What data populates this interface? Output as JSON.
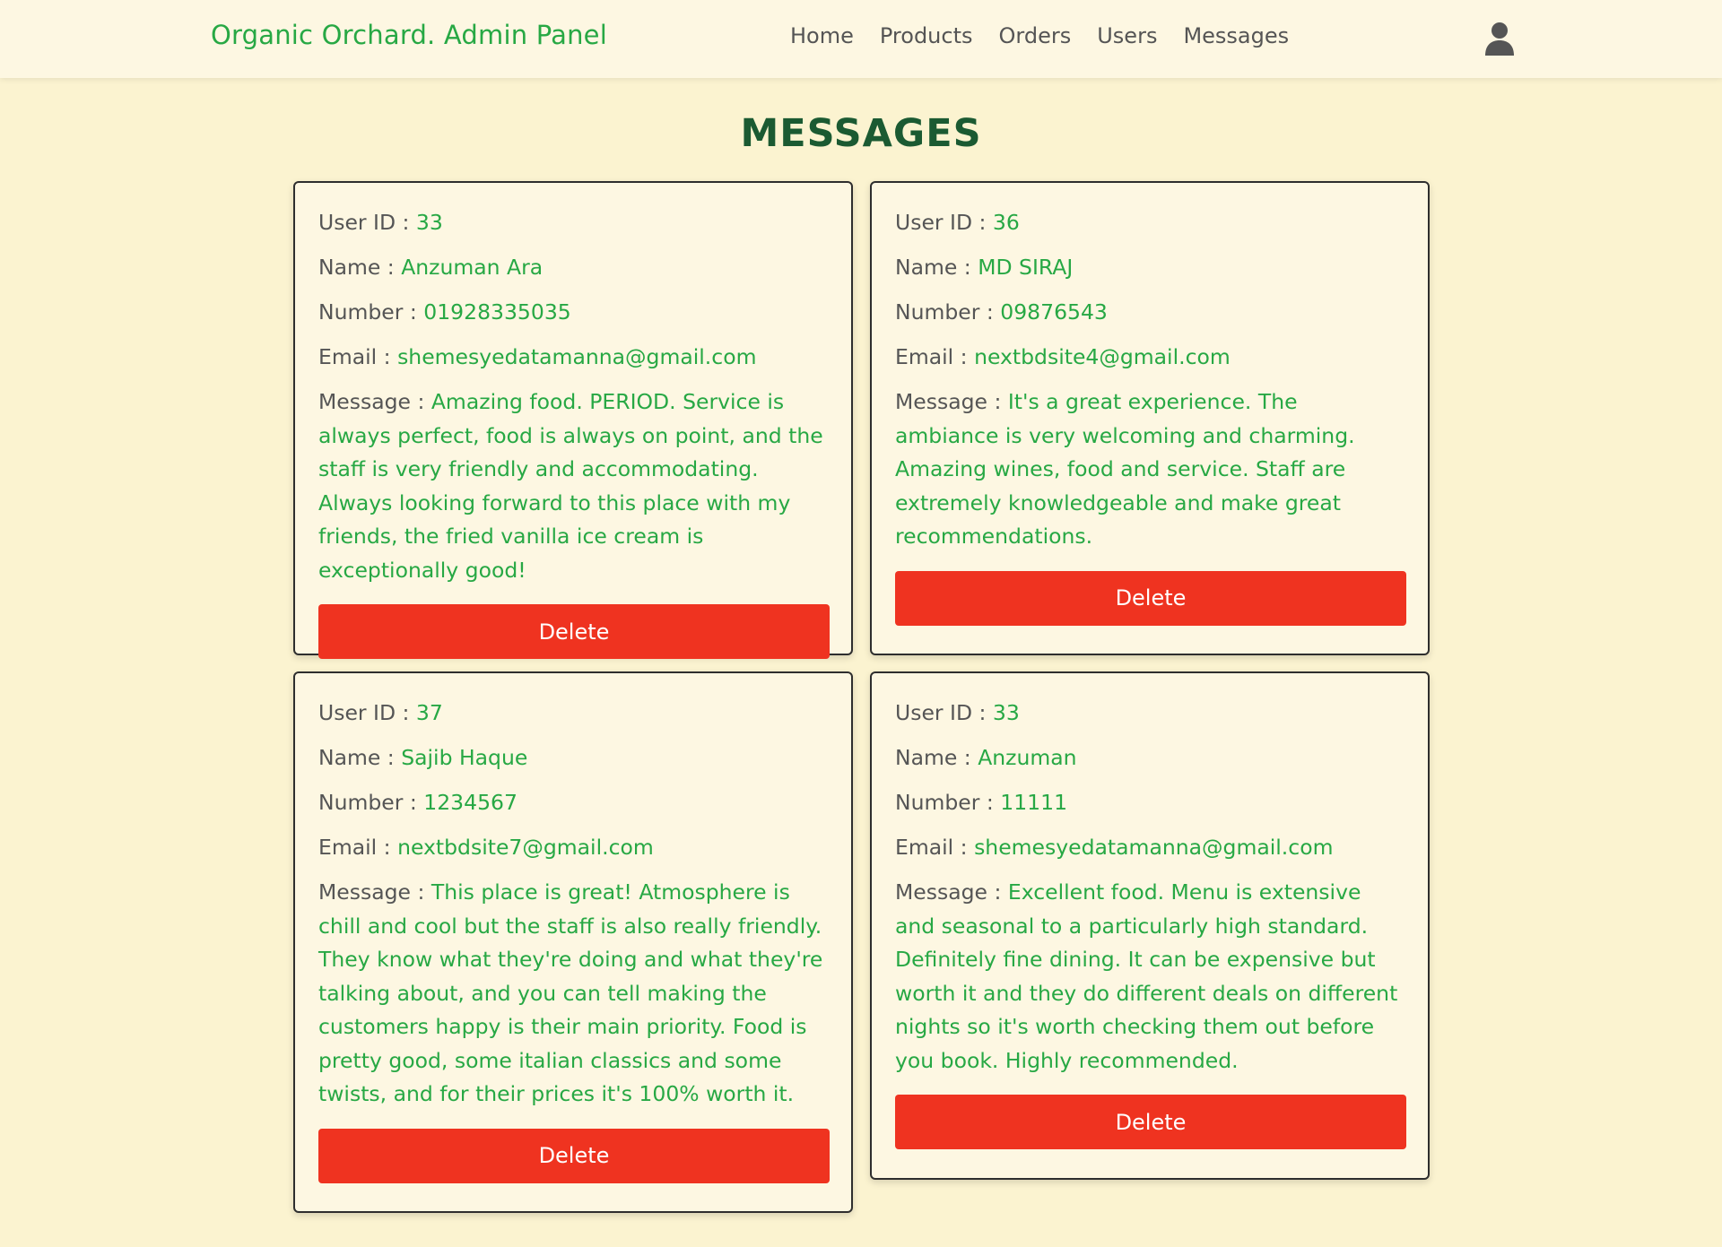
{
  "header": {
    "logo": "Organic Orchard. Admin Panel",
    "nav": [
      "Home",
      "Products",
      "Orders",
      "Users",
      "Messages"
    ],
    "user_icon": "user-icon"
  },
  "page": {
    "title": "MESSAGES"
  },
  "labels": {
    "user_id": "User ID : ",
    "name": "Name : ",
    "number": "Number : ",
    "email": "Email : ",
    "message": "Message : ",
    "delete": "Delete"
  },
  "messages": [
    {
      "user_id": "33",
      "name": "Anzuman Ara",
      "number": "01928335035",
      "email": "shemesyedatamanna@gmail.com",
      "message": "Amazing food. PERIOD. Service is always perfect, food is always on point, and the staff is very friendly and accommodating. Always looking forward to this place with my friends, the fried vanilla ice cream is exceptionally good!"
    },
    {
      "user_id": "36",
      "name": "MD SIRAJ",
      "number": "09876543",
      "email": "nextbdsite4@gmail.com",
      "message": "It's a great experience. The ambiance is very welcoming and charming. Amazing wines, food and service. Staff are extremely knowledgeable and make great recommendations."
    },
    {
      "user_id": "37",
      "name": "Sajib Haque",
      "number": "1234567",
      "email": "nextbdsite7@gmail.com",
      "message": "This place is great! Atmosphere is chill and cool but the staff is also really friendly. They know what they're doing and what they're talking about, and you can tell making the customers happy is their main priority. Food is pretty good, some italian classics and some twists, and for their prices it's 100% worth it."
    },
    {
      "user_id": "33",
      "name": "Anzuman",
      "number": "11111",
      "email": "shemesyedatamanna@gmail.com",
      "message": "Excellent food. Menu is extensive and seasonal to a particularly high standard. Definitely fine dining. It can be expensive but worth it and they do different deals on different nights so it's worth checking them out before you book. Highly recommended."
    }
  ],
  "colors": {
    "background": "#fbf3d0",
    "header_bg": "#fdf7e2",
    "accent_green": "#27a844",
    "title_green": "#1b5a32",
    "delete_red": "#ef3320"
  }
}
